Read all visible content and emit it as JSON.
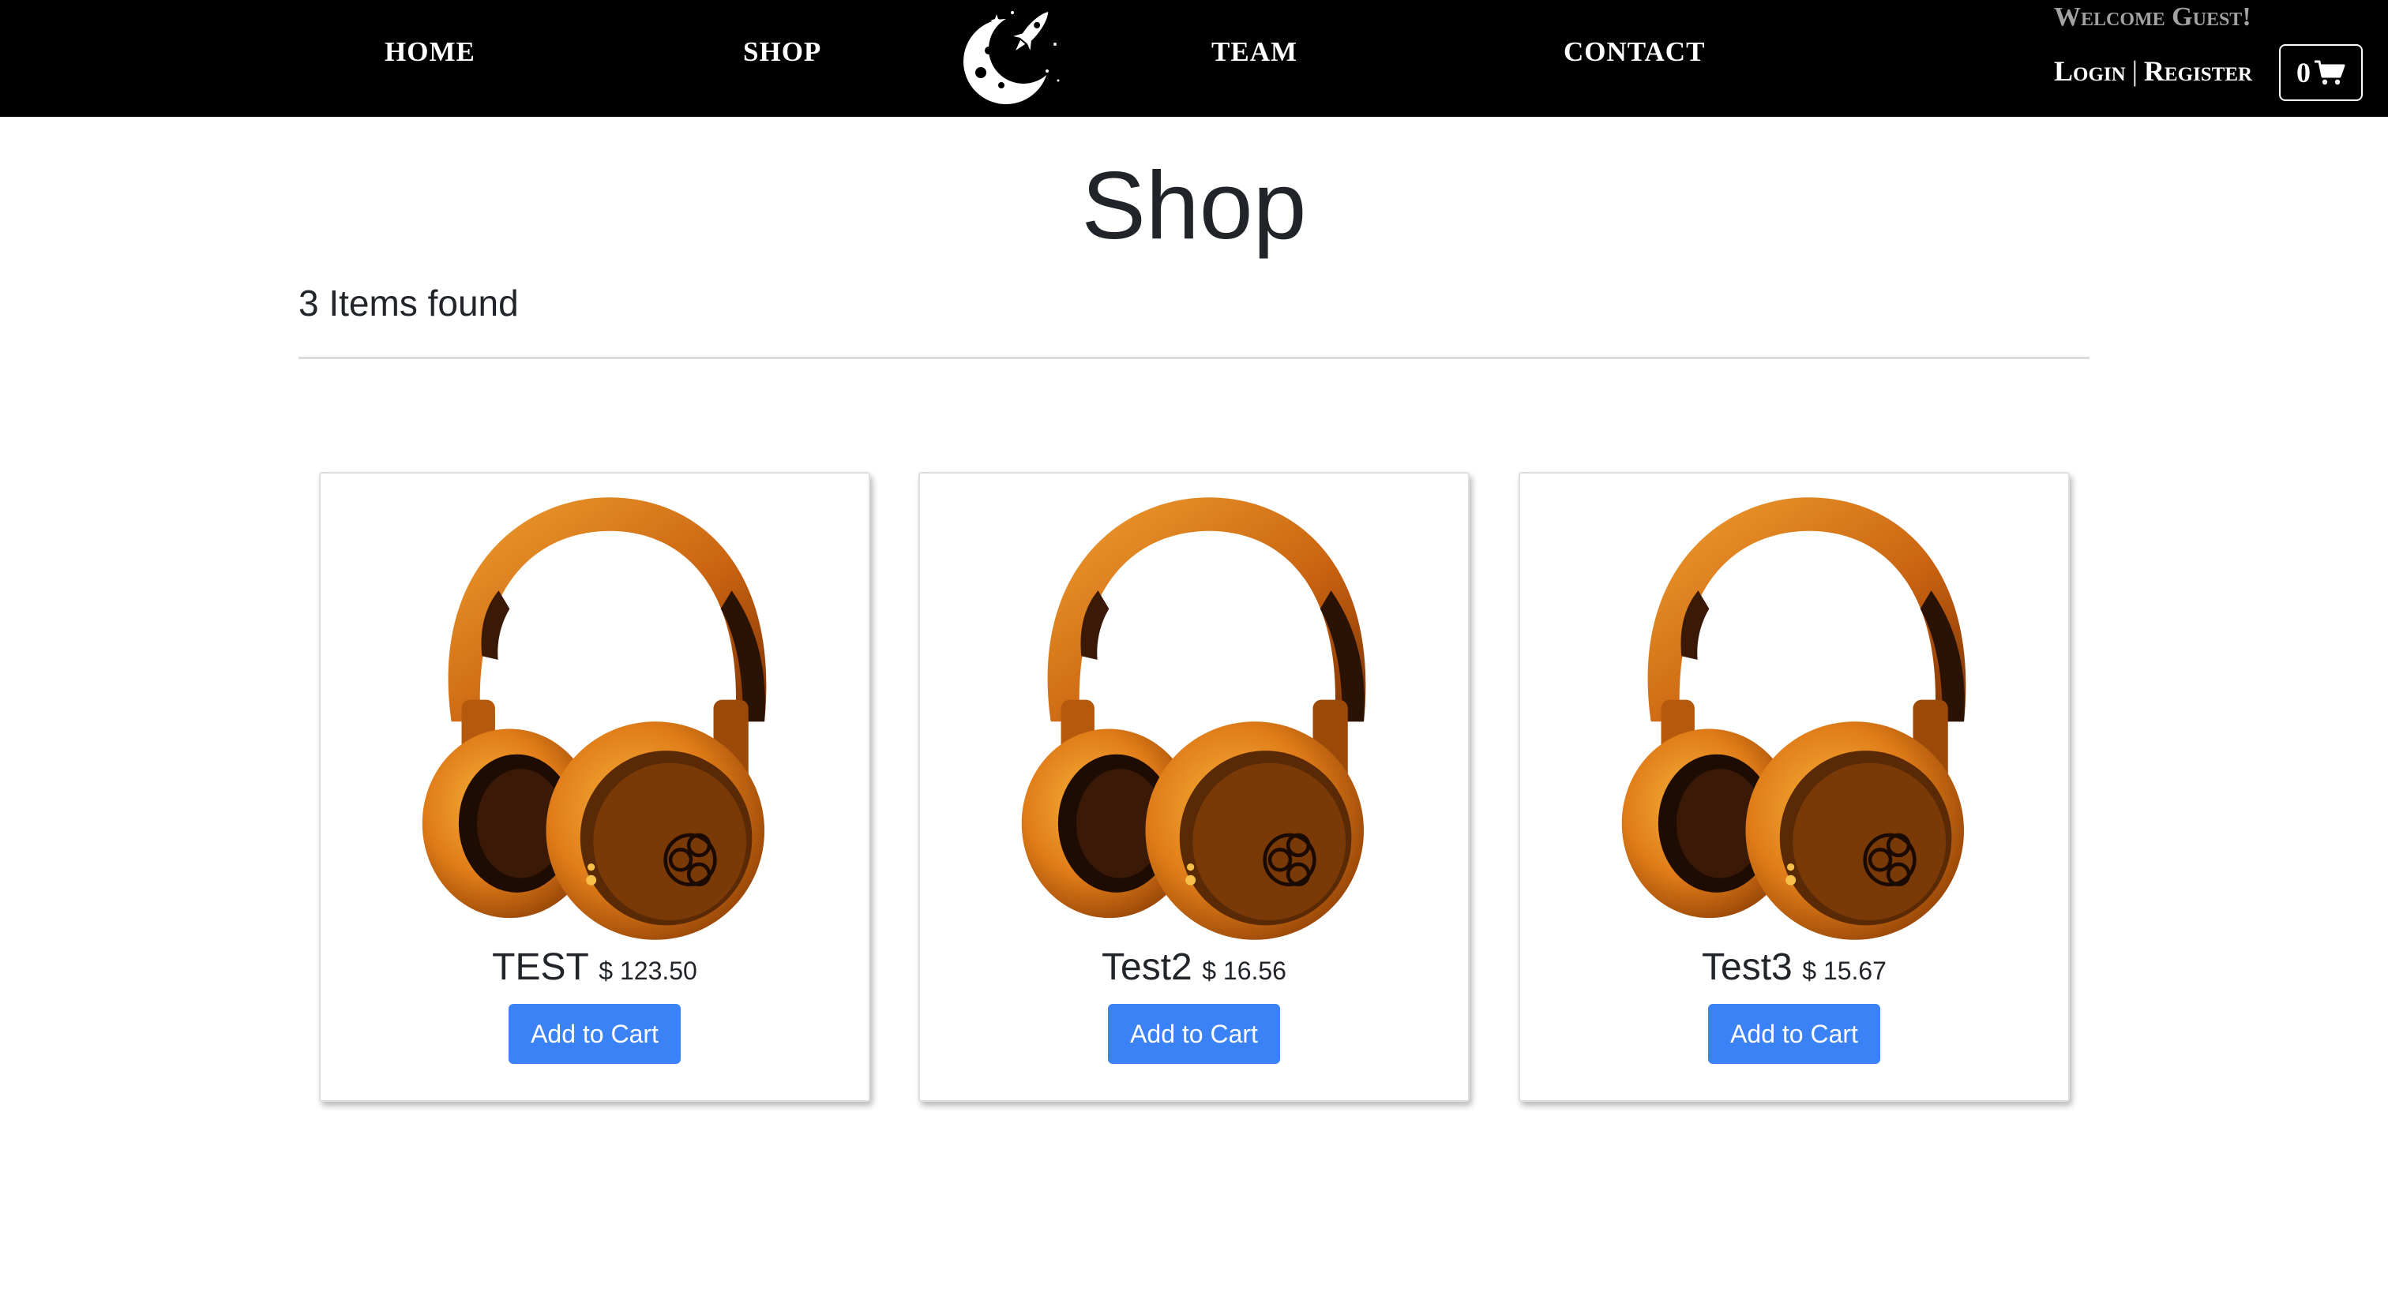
{
  "nav": {
    "links": [
      "HOME",
      "SHOP",
      "TEAM",
      "CONTACT"
    ],
    "logo_icon": "moon-rocket-logo-icon",
    "welcome_text": "Welcome Guest!",
    "login_label": "Login",
    "separator": "|",
    "register_label": "Register",
    "cart_count": "0",
    "cart_icon": "shopping-cart-icon"
  },
  "page": {
    "title": "Shop",
    "items_found": "3 Items found"
  },
  "products": [
    {
      "name": "TEST",
      "price": "$ 123.50",
      "button_label": "Add to Cart",
      "image_icon": "headphones-image"
    },
    {
      "name": "Test2",
      "price": "$ 16.56",
      "button_label": "Add to Cart",
      "image_icon": "headphones-image"
    },
    {
      "name": "Test3",
      "price": "$ 15.67",
      "button_label": "Add to Cart",
      "image_icon": "headphones-image"
    }
  ],
  "colors": {
    "navbar_bg": "#000000",
    "accent_button": "#3b82f6",
    "product_orange": "#e8821c"
  }
}
